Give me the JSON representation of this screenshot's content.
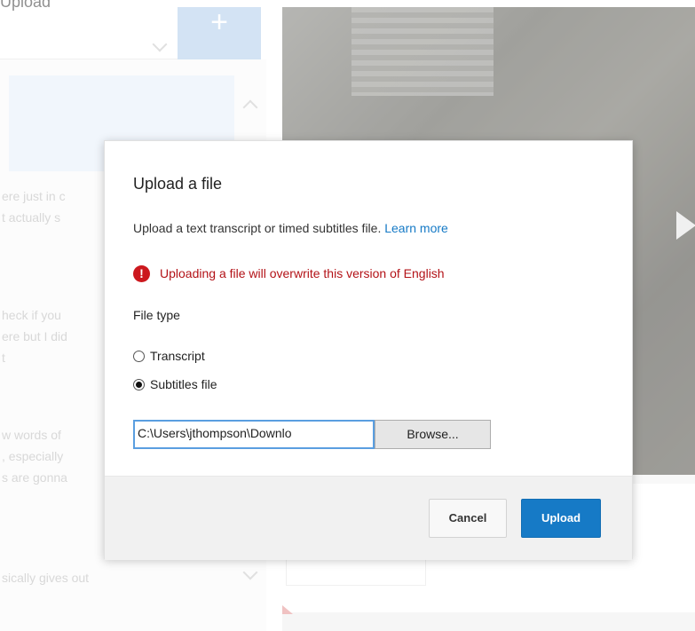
{
  "background": {
    "page_title": "Upload",
    "add_button_label": "+",
    "transcript_lines": [
      "ere just in c",
      "t actually s",
      "heck if you",
      "ere but I did",
      "t",
      "w words of",
      ", especially",
      "s are gonna",
      "sically gives out"
    ]
  },
  "dialog": {
    "title": "Upload a file",
    "description": "Upload a text transcript or timed subtitles file.",
    "learn_more": "Learn more",
    "warning_icon": "!",
    "warning": "Uploading a file will overwrite this version of English",
    "file_type_label": "File type",
    "options": [
      {
        "label": "Transcript",
        "selected": false
      },
      {
        "label": "Subtitles file",
        "selected": true
      }
    ],
    "file_path": "C:\\Users\\jthompson\\Downlo",
    "browse_label": "Browse...",
    "cancel_label": "Cancel",
    "upload_label": "Upload"
  },
  "colors": {
    "accent": "#167ac6",
    "warning": "#cc181e"
  }
}
